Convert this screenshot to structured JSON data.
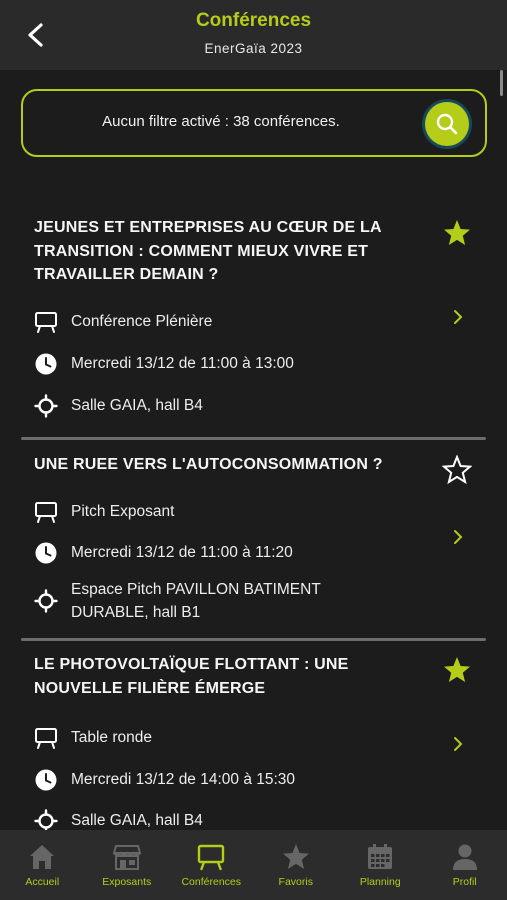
{
  "header": {
    "title": "Conférences",
    "subtitle": "EnerGaïa 2023"
  },
  "filter": {
    "text": "Aucun filtre activé : 38 conférences."
  },
  "conferences": [
    {
      "title": "JEUNES ET ENTREPRISES AU CŒUR DE LA TRANSITION : COMMENT MIEUX VIVRE ET TRAVAILLER DEMAIN ?",
      "favorite": true,
      "type": "Conférence Plénière",
      "schedule": "Mercredi 13/12 de 11:00 à 13:00",
      "location": "Salle GAIA, hall B4"
    },
    {
      "title": "UNE RUEE VERS L'AUTOCONSOMMATION ?",
      "favorite": false,
      "type": "Pitch Exposant",
      "schedule": "Mercredi 13/12 de 11:00 à 11:20",
      "location": "Espace Pitch PAVILLON BATIMENT DURABLE, hall B1"
    },
    {
      "title": "LE PHOTOVOLTAÏQUE FLOTTANT : UNE NOUVELLE FILIÈRE ÉMERGE",
      "favorite": true,
      "type": "Table ronde",
      "schedule": "Mercredi 13/12 de 14:00 à 15:30",
      "location": "Salle GAIA, hall B4"
    }
  ],
  "tabs": [
    {
      "label": "Accueil",
      "icon": "home-icon"
    },
    {
      "label": "Exposants",
      "icon": "store-icon"
    },
    {
      "label": "Conférences",
      "icon": "presentation-icon"
    },
    {
      "label": "Favoris",
      "icon": "star-icon"
    },
    {
      "label": "Planning",
      "icon": "calendar-icon"
    },
    {
      "label": "Profil",
      "icon": "person-icon"
    }
  ],
  "colors": {
    "accent": "#b5cc18",
    "background": "#1c1c1c",
    "bar": "#2c2c2c"
  }
}
